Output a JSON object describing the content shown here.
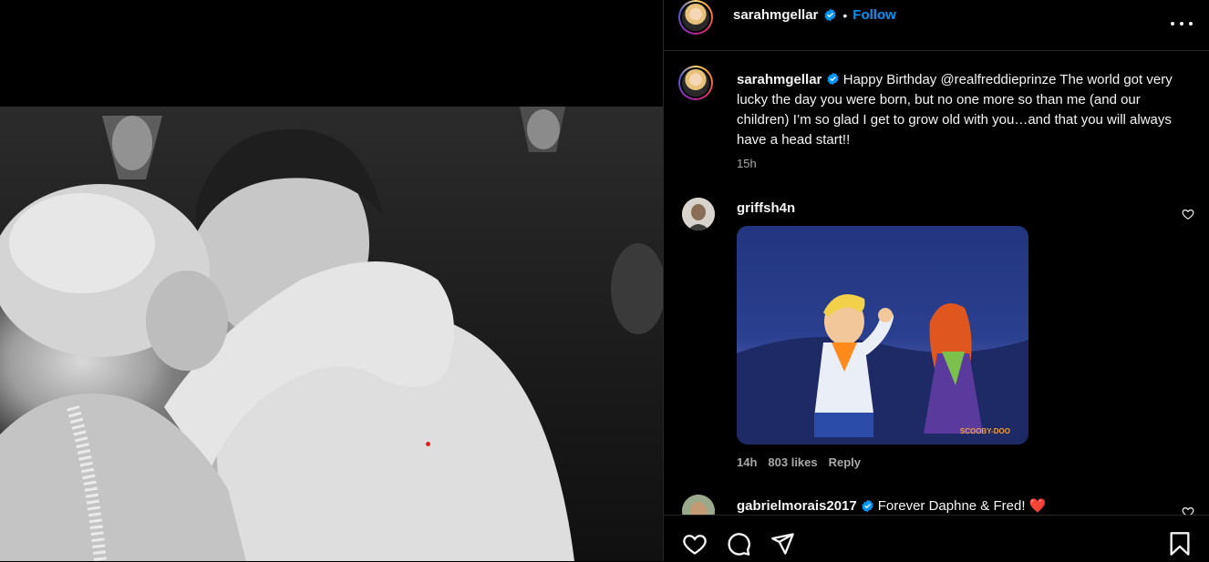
{
  "post": {
    "username": "sarahmgellar",
    "follow_label": "Follow",
    "separator": "•",
    "caption_text": "Happy Birthday @realfreddieprinze The world got very lucky the day you were born, but no one more so than me (and our children) I’m so glad I get to grow old with you…and that you will always have a head start!!",
    "time": "15h"
  },
  "comments": [
    {
      "username": "griffsh4n",
      "time": "14h",
      "likes": "803 likes",
      "reply_label": "Reply",
      "gif_watermark": "SCOOBY-DOO"
    },
    {
      "username": "gabrielmorais2017",
      "text": "Forever Daphne & Fred!",
      "emoji": "❤️"
    }
  ],
  "colors": {
    "accent": "#0095f6",
    "verified": "#0095f6",
    "background": "#000000",
    "muted": "#a8a8a8",
    "divider": "#262626"
  },
  "icons": {
    "more": "more-horizontal-icon",
    "like": "heart-icon",
    "comment": "comment-bubble-icon",
    "share": "paper-plane-icon",
    "save": "bookmark-icon",
    "verified": "verified-badge-icon"
  }
}
